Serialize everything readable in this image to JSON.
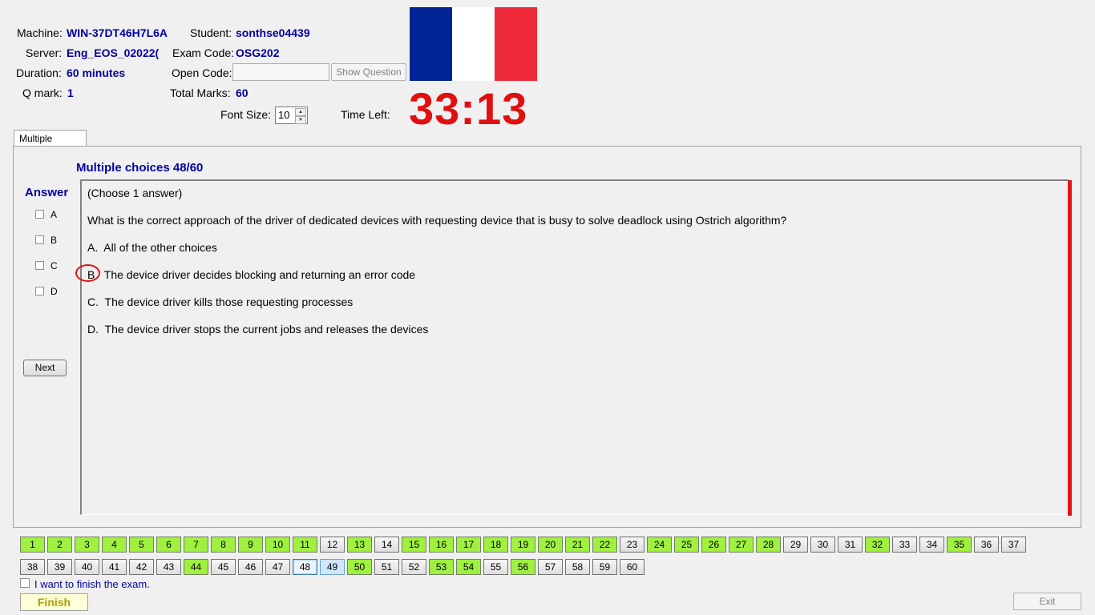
{
  "header": {
    "machine_label": "Machine:",
    "machine_value": "WIN-37DT46H7L6A",
    "student_label": "Student:",
    "student_value": "sonthse04439",
    "server_label": "Server:",
    "server_value": "Eng_EOS_02022(",
    "exam_code_label": "Exam Code:",
    "exam_code_value": "OSG202",
    "duration_label": "Duration:",
    "duration_value": "60 minutes",
    "open_code_label": "Open Code:",
    "open_code_value": "",
    "show_question_label": "Show Question",
    "qmark_label": "Q mark:",
    "qmark_value": "1",
    "total_marks_label": "Total Marks:",
    "total_marks_value": "60",
    "font_size_label": "Font Size:",
    "font_size_value": "10",
    "time_left_label": "Time Left:",
    "timer_value": "33:13",
    "flag_colors": [
      "#002395",
      "#ffffff",
      "#ed2939"
    ]
  },
  "tabs": [
    {
      "label": "Multiple Choices"
    }
  ],
  "question": {
    "title": "Multiple choices 48/60",
    "instruction": "(Choose 1 answer)",
    "text": "What is the correct approach of the driver of dedicated devices with requesting device that is busy to solve deadlock using Ostrich algorithm?",
    "options": [
      {
        "letter": "A.",
        "text": "All of the other choices"
      },
      {
        "letter": "B",
        "text": "The device driver decides blocking and returning an error code"
      },
      {
        "letter": "C.",
        "text": "The device driver kills those requesting processes"
      },
      {
        "letter": "D.",
        "text": "The device driver stops the current jobs and releases the devices"
      }
    ]
  },
  "answer_panel": {
    "title": "Answer",
    "choices": [
      "A",
      "B",
      "C",
      "D"
    ],
    "checked": [],
    "next_label": "Next"
  },
  "navigation": {
    "answered": [
      1,
      2,
      3,
      4,
      5,
      6,
      7,
      8,
      9,
      10,
      11,
      13,
      15,
      16,
      17,
      18,
      19,
      20,
      21,
      22,
      24,
      25,
      26,
      27,
      28,
      32,
      35,
      44,
      50,
      53,
      54,
      56
    ],
    "current": 48,
    "highlighted": 49,
    "total": 60
  },
  "footer": {
    "finish_checkbox_label": "I want to finish the exam.",
    "finish_label": "Finish",
    "exit_label": "Exit"
  },
  "colors": {
    "answered": "#a0f040",
    "accent_blue": "#0000a0",
    "timer_red": "#e01010"
  }
}
